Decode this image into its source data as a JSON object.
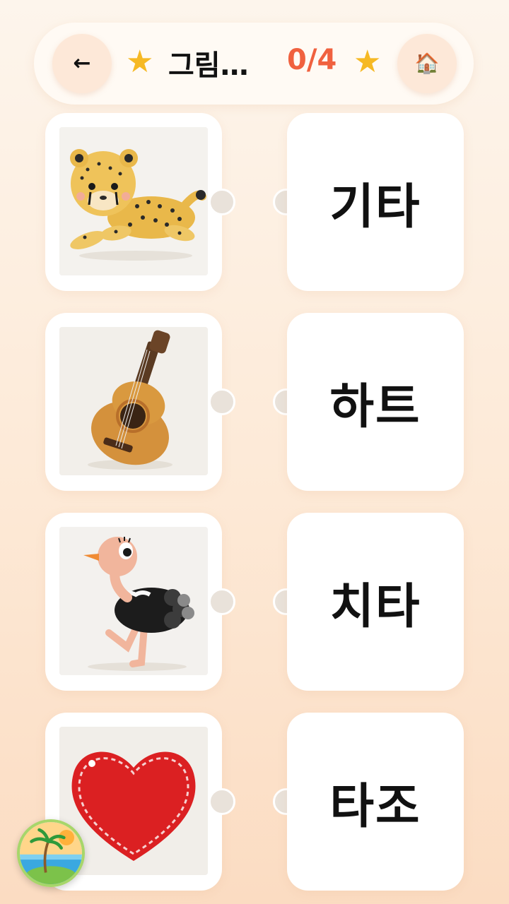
{
  "header": {
    "back_icon": "back-arrow-icon",
    "back_glyph": "←",
    "star_glyph": "★",
    "title": "그림…",
    "score": "0/4",
    "home_icon": "house-icon",
    "home_glyph": "🏠"
  },
  "pictures": [
    {
      "name": "cheetah"
    },
    {
      "name": "guitar"
    },
    {
      "name": "ostrich"
    },
    {
      "name": "heart"
    }
  ],
  "words": [
    "기타",
    "하트",
    "치타",
    "타조"
  ],
  "colors": {
    "accent_score": "#f0613f",
    "star": "#f6b924",
    "connector_dot": "#e9e2da",
    "background_top": "#fdf5ec",
    "background_bottom": "#fbdcc2"
  }
}
